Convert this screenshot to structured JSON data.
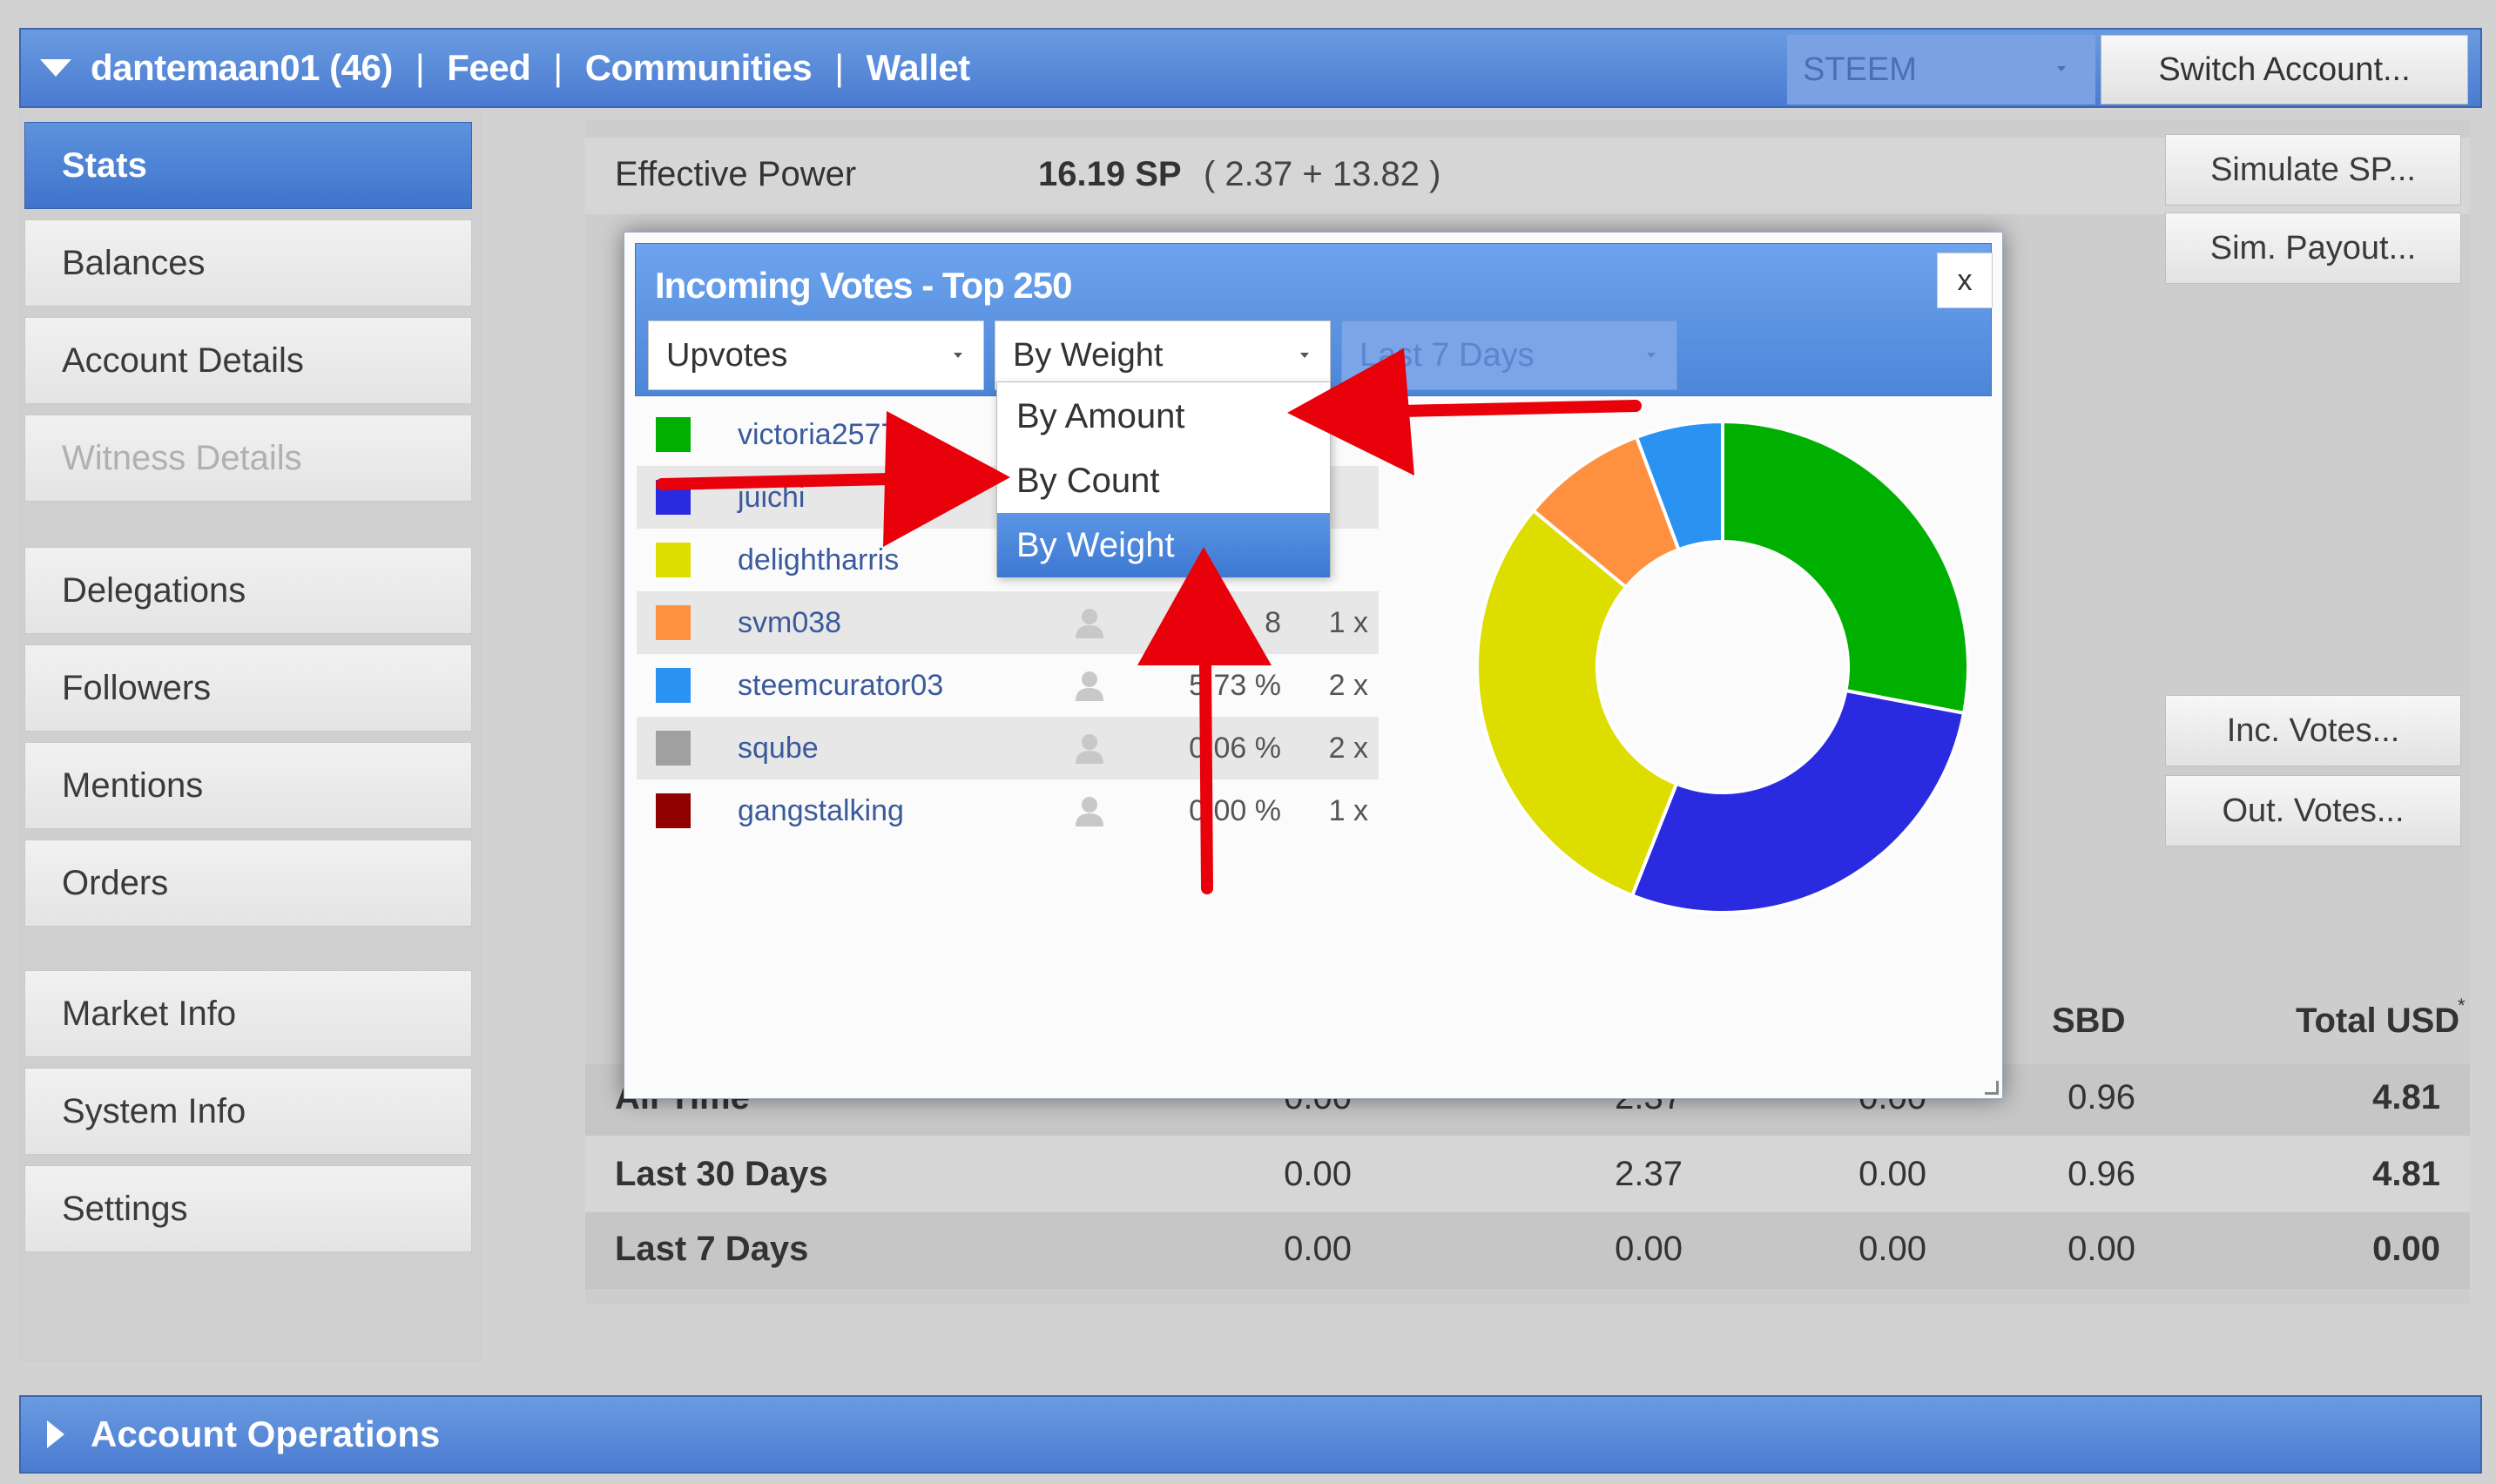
{
  "topbar": {
    "username": "dantemaan01 (46)",
    "sep": "|",
    "links": [
      "Feed",
      "Communities",
      "Wallet"
    ],
    "chain": "STEEM",
    "switch_label": "Switch Account..."
  },
  "sidebar": {
    "items": [
      {
        "label": "Stats"
      },
      {
        "label": "Balances"
      },
      {
        "label": "Account Details"
      },
      {
        "label": "Witness Details"
      },
      {
        "label": "Delegations"
      },
      {
        "label": "Followers"
      },
      {
        "label": "Mentions"
      },
      {
        "label": "Orders"
      },
      {
        "label": "Market Info"
      },
      {
        "label": "System Info"
      },
      {
        "label": "Settings"
      }
    ]
  },
  "main": {
    "effective_label": "Effective Power",
    "effective_value": "16.19 SP",
    "effective_detail": "( 2.37 + 13.82 )",
    "simulate_label": "Simulate SP...",
    "sim_payout_label": "Sim. Payout...",
    "inc_votes_label": "Inc. Votes...",
    "out_votes_label": "Out. Votes...",
    "table": {
      "headers": [
        "SBD",
        "Total USD"
      ],
      "asterisk": "*",
      "rows": [
        {
          "label": "All Time",
          "c1": "0.00",
          "c2": "2.37",
          "c3": "0.00",
          "sbd": "0.96",
          "total": "4.81"
        },
        {
          "label": "Last 30 Days",
          "c1": "0.00",
          "c2": "2.37",
          "c3": "0.00",
          "sbd": "0.96",
          "total": "4.81"
        },
        {
          "label": "Last 7 Days",
          "c1": "0.00",
          "c2": "0.00",
          "c3": "0.00",
          "sbd": "0.00",
          "total": "0.00"
        }
      ]
    }
  },
  "bottombar": {
    "label": "Account Operations"
  },
  "dialog": {
    "title": "Incoming Votes - Top 250",
    "close": "x",
    "type_select": "Upvotes",
    "sort_select": "By Weight",
    "period_select": "Last 7 Days",
    "dropdown": [
      "By Amount",
      "By Count",
      "By Weight"
    ],
    "votes": [
      {
        "name": "victoria2577",
        "color": "#00b000",
        "pct": "",
        "count": ""
      },
      {
        "name": "juichi",
        "color": "#2a2ae0",
        "pct": "",
        "count": ""
      },
      {
        "name": "delightharris",
        "color": "#dddd00",
        "pct": "",
        "count": ""
      },
      {
        "name": "svm038",
        "color": "#ff9040",
        "pct": "8",
        "count": "1 x"
      },
      {
        "name": "steemcurator03",
        "color": "#2a93f2",
        "pct": "5.73 %",
        "count": "2 x"
      },
      {
        "name": "sqube",
        "color": "#a0a0a0",
        "pct": "0.06 %",
        "count": "2 x"
      },
      {
        "name": "gangstalking",
        "color": "#900000",
        "pct": "0.00 %",
        "count": "1 x"
      }
    ]
  },
  "chart_data": {
    "type": "pie",
    "series": [
      {
        "color": "#00b000",
        "value": 28.0
      },
      {
        "color": "#2a2ae0",
        "value": 28.0
      },
      {
        "color": "#dddd00",
        "value": 30.0
      },
      {
        "color": "#ff9040",
        "value": 8.3
      },
      {
        "color": "#2a93f2",
        "value": 5.7
      }
    ]
  }
}
